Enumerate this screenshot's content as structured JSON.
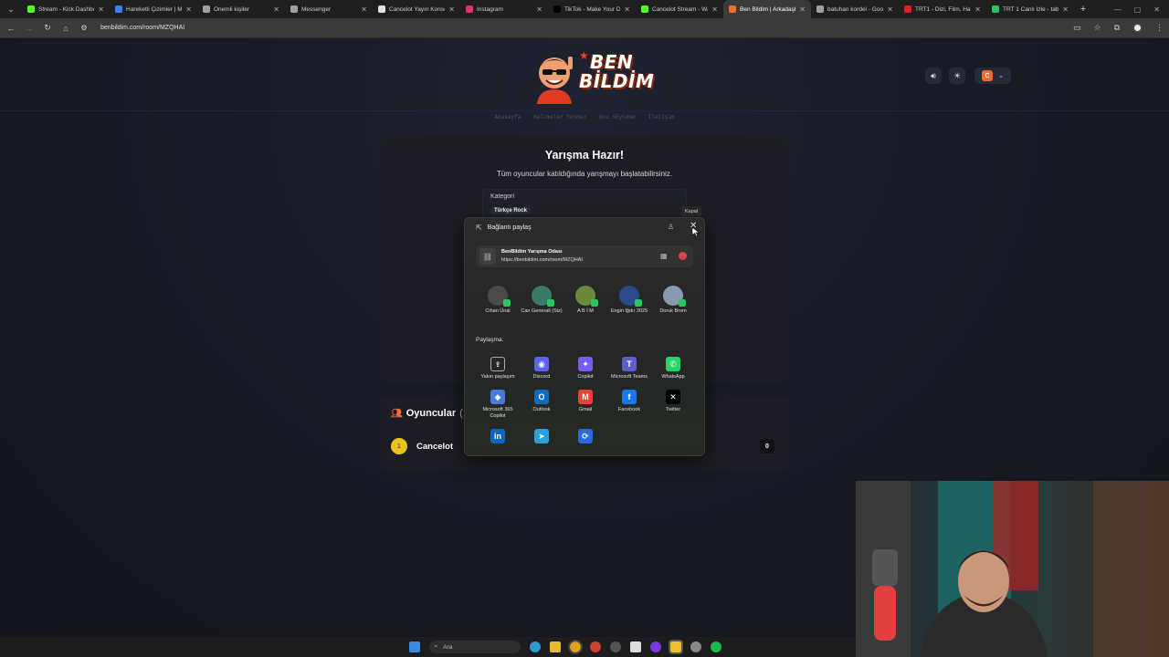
{
  "browser": {
    "tabs": [
      {
        "title": "Stream - Kick Dashboa",
        "color": "#53fc18"
      },
      {
        "title": "Hareketli Çizimler | Mi",
        "color": "#3b82f6"
      },
      {
        "title": "Önemli kişiler",
        "color": "#9aa0a6"
      },
      {
        "title": "Messenger",
        "color": "#9aa0a6"
      },
      {
        "title": "Cancelot Yayın Konsep",
        "color": "#e0e0e0"
      },
      {
        "title": "Instagram",
        "color": "#e1306c"
      },
      {
        "title": "TikTok - Make Your Da",
        "color": "#000000"
      },
      {
        "title": "Cancelot Stream - Wa",
        "color": "#53fc18"
      },
      {
        "title": "Ben Bildim | Arkadaşla",
        "color": "#f26a2e"
      },
      {
        "title": "batuhan kordel - Goo",
        "color": "#9aa0a6"
      },
      {
        "title": "TRT1 - Dizi, Film, Habe",
        "color": "#e02020"
      },
      {
        "title": "TRT 1 Canlı İzle - tabii",
        "color": "#22c55e"
      }
    ],
    "active_tab_index": 8,
    "url": "benbildim.com/room/MZQHAI"
  },
  "site": {
    "logo_line1": "BEN",
    "logo_line2": "BİLDİM",
    "nav": [
      "Anasayfa",
      "Kelimeler Yetmez",
      "Onu Söyleme",
      "İletişim"
    ],
    "user_initial": "C"
  },
  "game": {
    "title": "Yarışma Hazır!",
    "subtitle": "Tüm oyuncular katıldığında yarışmayı başlatabilirsiniz.",
    "category_label": "Kategori",
    "category_value": "Türkçe Rock"
  },
  "players": {
    "heading": "Oyuncular",
    "heading_count": "(1",
    "list": [
      {
        "rank": "1",
        "name": "Cancelot",
        "score": "0"
      }
    ]
  },
  "share": {
    "title": "Bağlantı paylaş",
    "close_tooltip": "Kapat",
    "link_title": "BenBildim Yarışma Odası",
    "link_url": "https://benbildim.com/room/MZQHAI",
    "contacts": [
      {
        "name": "Cihan Ünal",
        "avatar_color": "#4a4a4a"
      },
      {
        "name": "Can Generali (Siz)",
        "avatar_color": "#3a7a6a"
      },
      {
        "name": "A B İ M",
        "avatar_color": "#6a8a3a"
      },
      {
        "name": "Engin Iğdır 2025",
        "avatar_color": "#2a4a8a"
      },
      {
        "name": "Doruk Brom",
        "avatar_color": "#8a9ab0"
      }
    ],
    "share_via_label": "Paylaşma:",
    "apps": [
      {
        "name": "Yakın paylaşım",
        "icon": "nearby-share-icon",
        "color": "transparent",
        "glyph": "⇪"
      },
      {
        "name": "Discord",
        "icon": "discord-icon",
        "color": "#5865f2",
        "glyph": "◉"
      },
      {
        "name": "Copilot",
        "icon": "copilot-icon",
        "color": "#7a5cf0",
        "glyph": "✦"
      },
      {
        "name": "Microsoft Teams",
        "icon": "teams-icon",
        "color": "#5b5fc7",
        "glyph": "T"
      },
      {
        "name": "WhatsApp",
        "icon": "whatsapp-icon",
        "color": "#25d366",
        "glyph": "✆"
      },
      {
        "name": "Microsoft 365 Copilot",
        "icon": "m365-copilot-icon",
        "color": "#4a7ae0",
        "glyph": "◆"
      },
      {
        "name": "Outlook",
        "icon": "outlook-icon",
        "color": "#0f6cbd",
        "glyph": "O"
      },
      {
        "name": "Gmail",
        "icon": "gmail-icon",
        "color": "#ea4335",
        "glyph": "M"
      },
      {
        "name": "Facebook",
        "icon": "facebook-icon",
        "color": "#1877f2",
        "glyph": "f"
      },
      {
        "name": "Twitter",
        "icon": "twitter-icon",
        "color": "#000000",
        "glyph": "✕"
      },
      {
        "name": "",
        "icon": "linkedin-icon",
        "color": "#0a66c2",
        "glyph": "in"
      },
      {
        "name": "",
        "icon": "telegram-icon",
        "color": "#2aa0da",
        "glyph": "➤"
      },
      {
        "name": "",
        "icon": "share-app-icon",
        "color": "#2a6ae0",
        "glyph": "⟳"
      }
    ]
  },
  "taskbar": {
    "search_placeholder": "Ara"
  }
}
